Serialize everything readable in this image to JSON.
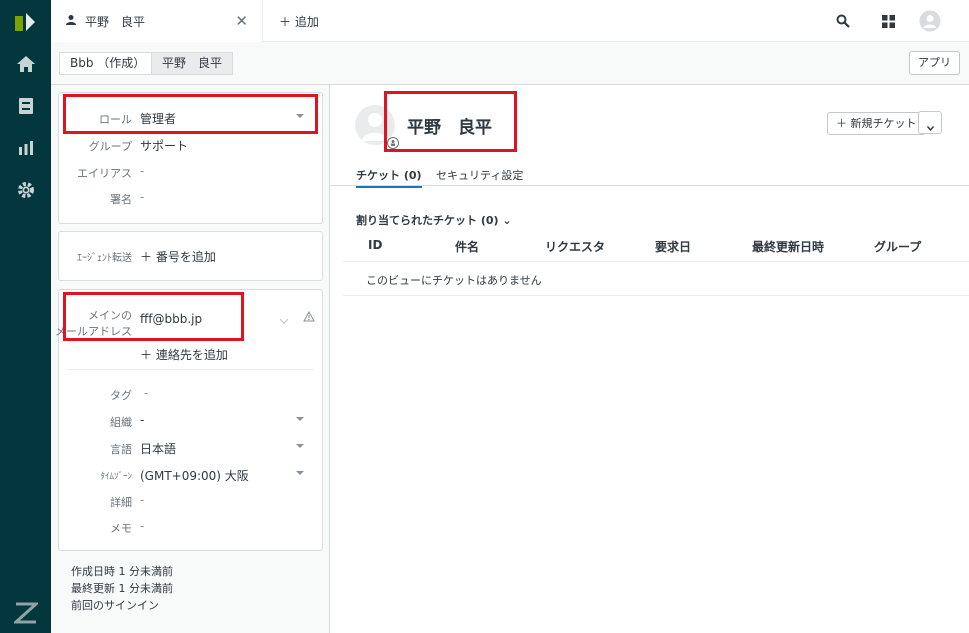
{
  "tabs": {
    "active_label": "平野　良平",
    "add_label": "＋ 追加"
  },
  "breadcrumb": {
    "org": "Bbb （作成）",
    "user": "平野　良平"
  },
  "apps_label": "アプリ",
  "user_fields": {
    "role": {
      "label": "ロール",
      "value": "管理者"
    },
    "group": {
      "label": "グループ",
      "value": "サポート"
    },
    "alias": {
      "label": "エイリアス",
      "value": "-"
    },
    "signature": {
      "label": "署名",
      "value": "-"
    }
  },
  "forwarding": {
    "label": "ｴｰｼﾞｪﾝﾄ転送",
    "value": "＋ 番号を追加"
  },
  "contact": {
    "email_label_line1": "メインの",
    "email_label_line2": "メールアドレス",
    "email_value": "fff@bbb.jp",
    "add_contact": "＋ 連絡先を追加"
  },
  "details": {
    "tags": {
      "label": "タグ",
      "value": "-"
    },
    "org": {
      "label": "組織",
      "value": "-"
    },
    "language": {
      "label": "言語",
      "value": "日本語"
    },
    "timezone": {
      "label": "ﾀｲﾑｿﾞｰﾝ",
      "value": "(GMT+09:00) 大阪"
    },
    "details": {
      "label": "詳細",
      "value": "-"
    },
    "notes": {
      "label": "メモ",
      "value": "-"
    }
  },
  "meta": {
    "created": "作成日時  1 分未満前",
    "updated": "最終更新  1 分未満前",
    "last_signin": "前回のサインイン"
  },
  "profile": {
    "name": "平野　良平",
    "new_ticket": "＋ 新規チケット"
  },
  "main_tabs": {
    "tickets": "チケット (0)",
    "security": "セキュリティ設定"
  },
  "assigned_title": "割り当てられたチケット (0) ⌄",
  "table": {
    "headers": [
      "ID",
      "件名",
      "リクエスタ",
      "要求日",
      "最終更新日時",
      "グループ"
    ],
    "empty": "このビューにチケットはありません"
  },
  "colors": {
    "nav_bg": "#03363d",
    "logo_green": "#78a300",
    "highlight": "#e0141e",
    "accent": "#1f73b7"
  }
}
